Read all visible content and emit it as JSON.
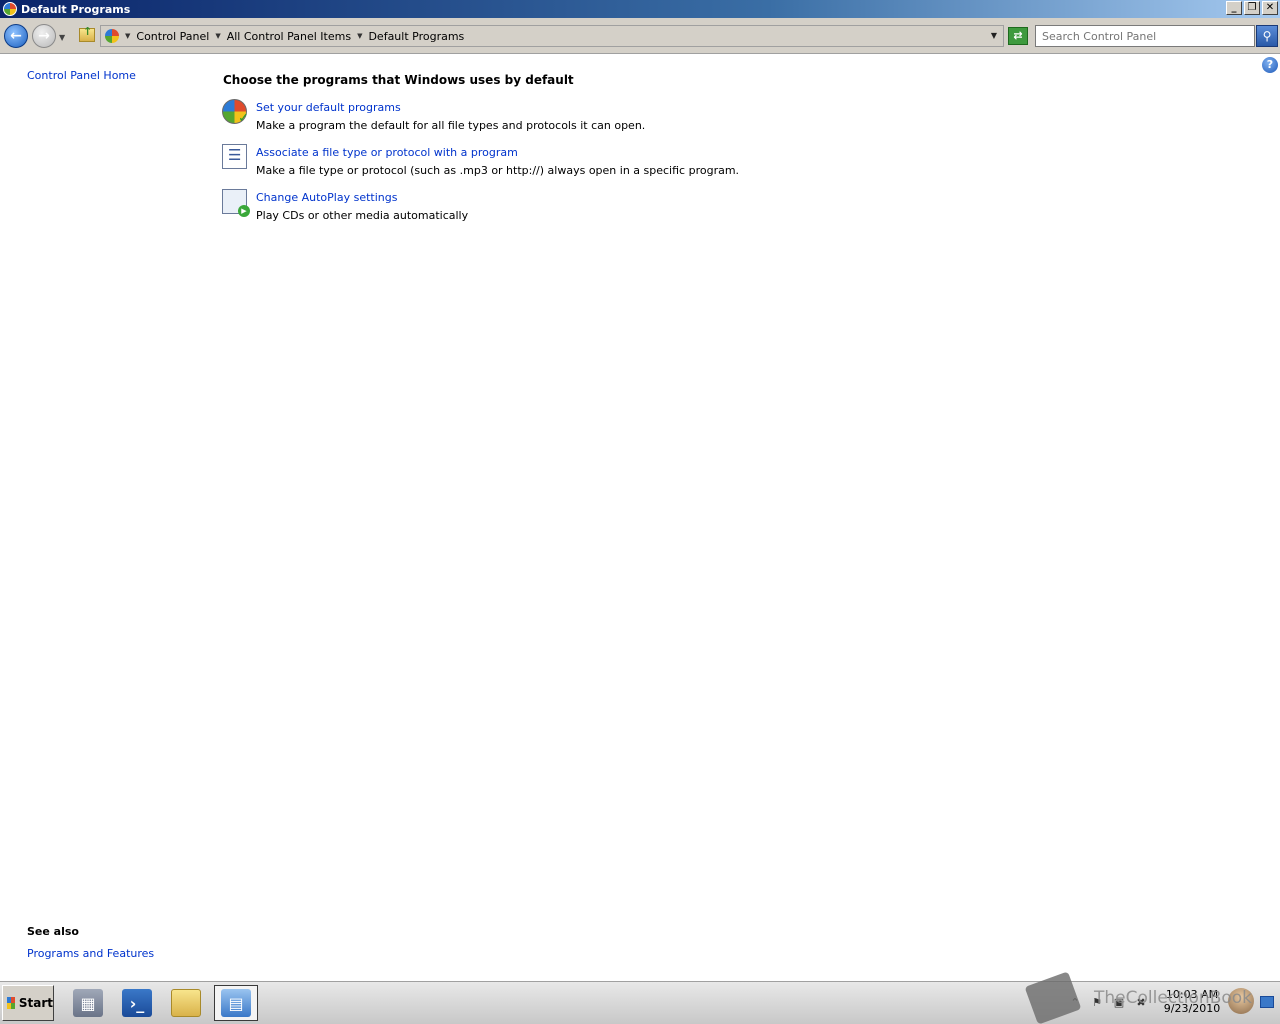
{
  "window": {
    "title": "Default Programs",
    "buttons": {
      "minimize": "_",
      "maximize": "❐",
      "close": "✕"
    }
  },
  "address_bar": {
    "breadcrumbs": [
      "Control Panel",
      "All Control Panel Items",
      "Default Programs"
    ],
    "search_placeholder": "Search Control Panel"
  },
  "sidebar": {
    "home_link": "Control Panel Home",
    "see_also_title": "See also",
    "see_also_links": [
      "Programs and Features"
    ]
  },
  "main": {
    "heading": "Choose the programs that Windows uses by default",
    "tasks": [
      {
        "icon": "default-programs-icon",
        "link": "Set your default programs",
        "description": "Make a program the default for all file types and protocols it can open."
      },
      {
        "icon": "file-association-icon",
        "link": "Associate a file type or protocol with a program",
        "description": "Make a file type or protocol (such as .mp3 or http://) always open in a specific program."
      },
      {
        "icon": "autoplay-icon",
        "link": "Change AutoPlay settings",
        "description": "Play CDs or other media automatically"
      }
    ]
  },
  "taskbar": {
    "start_label": "Start",
    "apps": [
      "server-manager-icon",
      "powershell-icon",
      "explorer-folder-icon",
      "control-panel-icon"
    ],
    "clock_time": "10:03 AM",
    "clock_date": "9/23/2010"
  },
  "watermark": {
    "text": "TheCollectionBook"
  }
}
